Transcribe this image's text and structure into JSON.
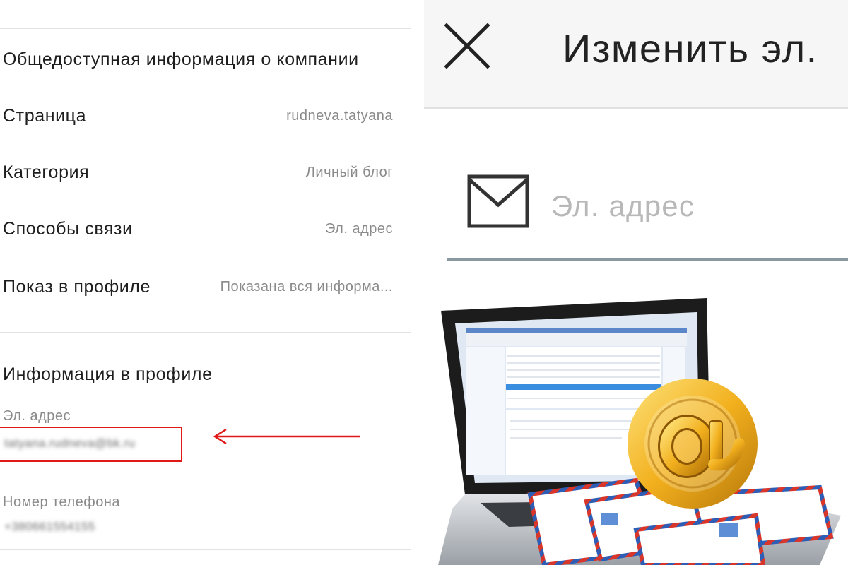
{
  "left": {
    "rows": [
      {
        "label": "Общедоступная информация о компании",
        "value": ""
      },
      {
        "label": "Страница",
        "value": "rudneva.tatyana"
      },
      {
        "label": "Категория",
        "value": "Личный блог"
      },
      {
        "label": "Способы связи",
        "value": "Эл. адрес"
      },
      {
        "label": "Показ в профиле",
        "value": "Показана вся информа..."
      }
    ],
    "profile_section": {
      "title": "Информация в профиле",
      "email_label": "Эл. адрес",
      "email_value": "tatyana.rudneva@bk.ru",
      "phone_label": "Номер телефона",
      "phone_value": "+380661554155"
    },
    "highlight_color": "#e01919"
  },
  "right": {
    "title": "Изменить эл.",
    "close_icon": "close-icon",
    "email_icon": "envelope-icon",
    "email_placeholder": "Эл. адрес",
    "email_value": ""
  },
  "colors": {
    "accent_red": "#e01919",
    "text_primary": "#1e1e1e",
    "text_secondary": "#8a8a8a",
    "at_gold": "#f2b01e"
  }
}
